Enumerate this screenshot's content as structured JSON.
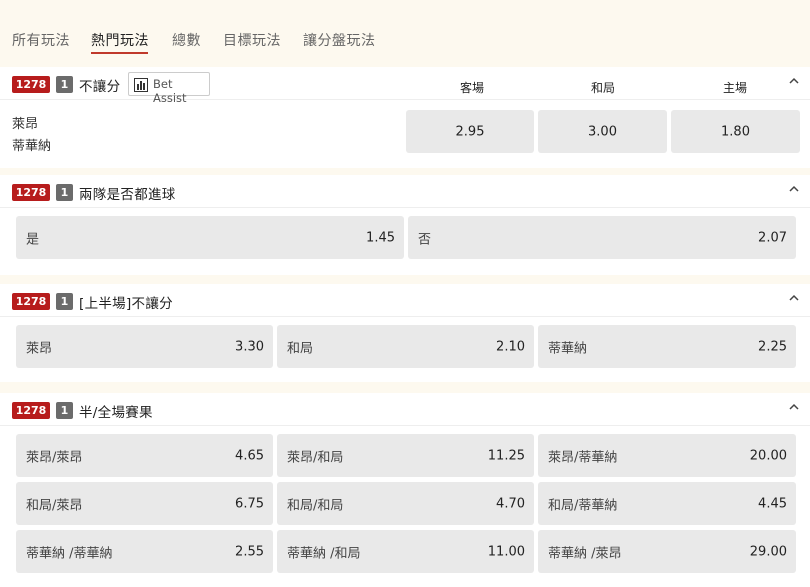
{
  "tabs": [
    {
      "label": "所有玩法",
      "active": false
    },
    {
      "label": "熱門玩法",
      "active": true
    },
    {
      "label": "總數",
      "active": false
    },
    {
      "label": "目標玩法",
      "active": false
    },
    {
      "label": "讓分盤玩法",
      "active": false
    }
  ],
  "colors": {
    "accent": "#b71c1c",
    "tab_underline": "#c0392b",
    "odd_button": "#e9e9e9"
  },
  "markets": [
    {
      "id": "1278",
      "num": "1",
      "title": "不讓分",
      "bet_assist": "Bet Assist",
      "columns": [
        "客場",
        "和局",
        "主場"
      ],
      "teams": [
        "萊昂",
        "蒂華納"
      ],
      "odds": [
        "2.95",
        "3.00",
        "1.80"
      ]
    },
    {
      "id": "1278",
      "num": "1",
      "title": "兩隊是否都進球",
      "options": [
        {
          "label": "是",
          "odds": "1.45"
        },
        {
          "label": "否",
          "odds": "2.07"
        }
      ]
    },
    {
      "id": "1278",
      "num": "1",
      "title": "[上半場]不讓分",
      "options": [
        {
          "label": "萊昂",
          "odds": "3.30"
        },
        {
          "label": "和局",
          "odds": "2.10"
        },
        {
          "label": "蒂華納",
          "odds": "2.25"
        }
      ]
    },
    {
      "id": "1278",
      "num": "1",
      "title": "半/全場賽果",
      "options": [
        {
          "label": "萊昂/萊昂",
          "odds": "4.65"
        },
        {
          "label": "萊昂/和局",
          "odds": "11.25"
        },
        {
          "label": "萊昂/蒂華納",
          "odds": "20.00"
        },
        {
          "label": "和局/萊昂",
          "odds": "6.75"
        },
        {
          "label": "和局/和局",
          "odds": "4.70"
        },
        {
          "label": "和局/蒂華納",
          "odds": "4.45"
        },
        {
          "label": "蒂華納 /蒂華納",
          "odds": "2.55"
        },
        {
          "label": "蒂華納 /和局",
          "odds": "11.00"
        },
        {
          "label": "蒂華納 /萊昂",
          "odds": "29.00"
        }
      ]
    }
  ]
}
